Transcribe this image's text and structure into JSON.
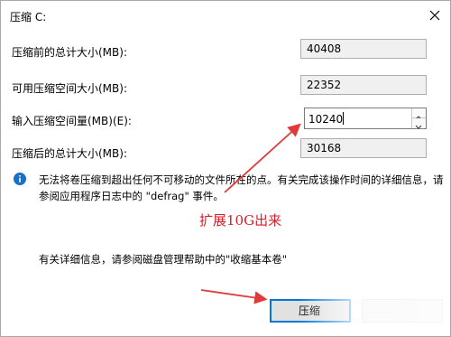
{
  "window": {
    "title": "压缩 C:"
  },
  "fields": {
    "total_before": {
      "label": "压缩前的总计大小(MB):",
      "value": "40408"
    },
    "available": {
      "label": "可用压缩空间大小(MB):",
      "value": "22352"
    },
    "input": {
      "label": "输入压缩空间量(MB)(E):",
      "value": "10240"
    },
    "total_after": {
      "label": "压缩后的总计大小(MB):",
      "value": "30168"
    }
  },
  "info": {
    "icon": "info-icon",
    "line1": "无法将卷压缩到超出任何不可移动的文件所在的点。有关完成该操作时间的详细信息，请",
    "line2": "参阅应用程序日志中的 \"defrag\" 事件。"
  },
  "annotation": {
    "text": "扩展10G出来",
    "color": "#d6212a"
  },
  "help": {
    "text": "有关详细信息，请参阅磁盘管理帮助中的\"收缩基本卷\""
  },
  "buttons": {
    "compress_label": "压缩"
  },
  "colors": {
    "accent": "#0078d7",
    "arrow": "#e03a3a",
    "info_icon": "#1a6fc9"
  }
}
